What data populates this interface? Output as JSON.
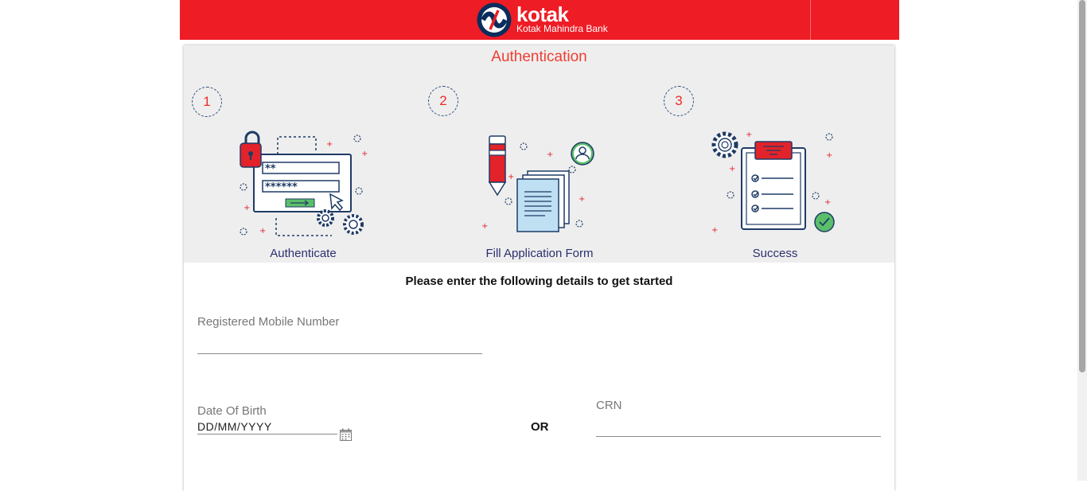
{
  "header": {
    "brand_name": "kotak",
    "brand_subtitle": "Kotak Mahindra Bank",
    "brand_color": "#ee1c25"
  },
  "auth": {
    "title": "Authentication",
    "steps": [
      {
        "number": "1",
        "label": "Authenticate",
        "icon": "login-illustration-icon"
      },
      {
        "number": "2",
        "label": "Fill Application Form",
        "icon": "form-illustration-icon"
      },
      {
        "number": "3",
        "label": "Success",
        "icon": "success-checklist-icon"
      }
    ]
  },
  "form": {
    "instruction": "Please enter the following details to get started",
    "mobile_label": "Registered Mobile Number",
    "dob_label": "Date Of Birth",
    "dob_value": "DD/MM/YYYY",
    "or_label": "OR",
    "crn_label": "CRN"
  }
}
